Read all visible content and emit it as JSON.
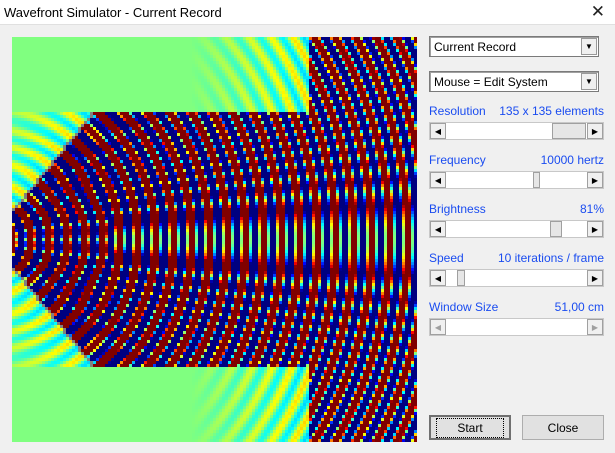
{
  "window": {
    "title": "Wavefront Simulator - Current Record",
    "close_icon": "close-icon"
  },
  "record_select": {
    "value": "Current Record"
  },
  "mouse_select": {
    "value": "Mouse = Edit System"
  },
  "resolution": {
    "label": "Resolution",
    "value": "135 x 135 elements",
    "fraction": 1.0
  },
  "frequency": {
    "label": "Frequency",
    "value": "10000 hertz",
    "fraction": 0.6
  },
  "brightness": {
    "label": "Brightness",
    "value": "81%",
    "fraction": 0.81
  },
  "speed": {
    "label": "Speed",
    "value": "10 iterations / frame",
    "fraction": 0.05
  },
  "window_size": {
    "label": "Window Size",
    "value": "51,00 cm",
    "enabled": false
  },
  "buttons": {
    "start": "Start",
    "close": "Close"
  },
  "simulation": {
    "grid_size": 135,
    "colormap": "jet",
    "background": "#80ff80"
  }
}
